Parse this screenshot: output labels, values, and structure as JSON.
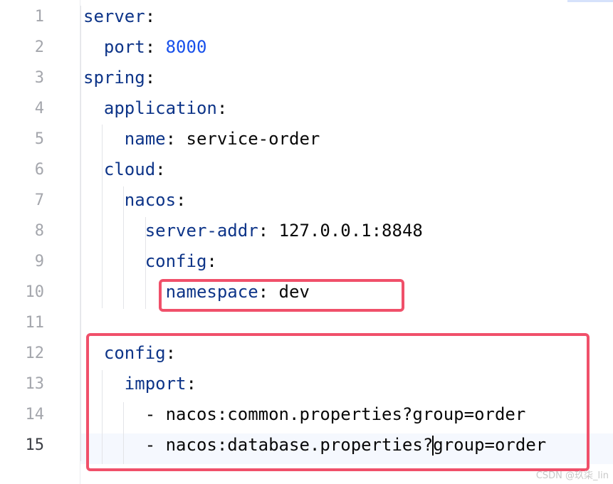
{
  "editor": {
    "line_numbers": [
      "1",
      "2",
      "3",
      "4",
      "5",
      "6",
      "7",
      "8",
      "9",
      "10",
      "11",
      "12",
      "13",
      "14",
      "15"
    ],
    "active_line": "15",
    "lines": [
      {
        "indent": "",
        "key": "server",
        "sep": ":",
        "value": "",
        "value_type": "txt"
      },
      {
        "indent": "  ",
        "key": "port",
        "sep": ": ",
        "value": "8000",
        "value_type": "num"
      },
      {
        "indent": "",
        "key": "spring",
        "sep": ":",
        "value": "",
        "value_type": "txt"
      },
      {
        "indent": "  ",
        "key": "application",
        "sep": ":",
        "value": "",
        "value_type": "txt"
      },
      {
        "indent": "    ",
        "key": "name",
        "sep": ": ",
        "value": "service-order",
        "value_type": "txt"
      },
      {
        "indent": "  ",
        "key": "cloud",
        "sep": ":",
        "value": "",
        "value_type": "txt"
      },
      {
        "indent": "    ",
        "key": "nacos",
        "sep": ":",
        "value": "",
        "value_type": "txt"
      },
      {
        "indent": "      ",
        "key": "server-addr",
        "sep": ": ",
        "value": "127.0.0.1:8848",
        "value_type": "txt"
      },
      {
        "indent": "      ",
        "key": "config",
        "sep": ":",
        "value": "",
        "value_type": "txt"
      },
      {
        "indent": "        ",
        "key": "namespace",
        "sep": ": ",
        "value": "dev",
        "value_type": "txt"
      },
      {
        "indent": "",
        "key": "",
        "sep": "",
        "value": "",
        "value_type": "txt"
      },
      {
        "indent": "  ",
        "key": "config",
        "sep": ":",
        "value": "",
        "value_type": "txt"
      },
      {
        "indent": "    ",
        "key": "import",
        "sep": ":",
        "value": "",
        "value_type": "txt"
      },
      {
        "indent": "      ",
        "key": "",
        "sep": "",
        "value": "- nacos:common.properties?group=order",
        "value_type": "txt"
      },
      {
        "indent": "      ",
        "key": "",
        "sep": "",
        "value": "- nacos:database.properties?group=order",
        "value_type": "txt"
      }
    ]
  },
  "colors": {
    "key": "#0d3488",
    "number": "#1750eb",
    "text": "#080808",
    "highlight_box": "#f0506a",
    "current_line_bg": "#f5f8fe"
  },
  "watermark": "CSDN @玖柒_lin"
}
